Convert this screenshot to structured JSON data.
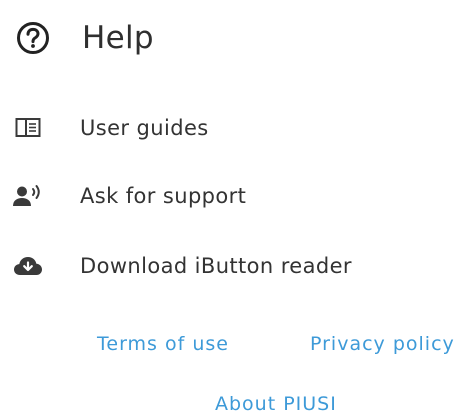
{
  "header": {
    "title": "Help",
    "icon": "help-circle-icon"
  },
  "menu": {
    "items": [
      {
        "label": "User guides",
        "icon": "book-icon"
      },
      {
        "label": "Ask for support",
        "icon": "support-person-icon"
      },
      {
        "label": "Download iButton reader",
        "icon": "cloud-download-icon"
      }
    ]
  },
  "footer": {
    "terms_label": "Terms of use",
    "privacy_label": "Privacy policy",
    "about_label": "About PIUSI"
  },
  "colors": {
    "link": "#3d9ad8",
    "text": "#333333",
    "icon": "#3a3a3a"
  }
}
